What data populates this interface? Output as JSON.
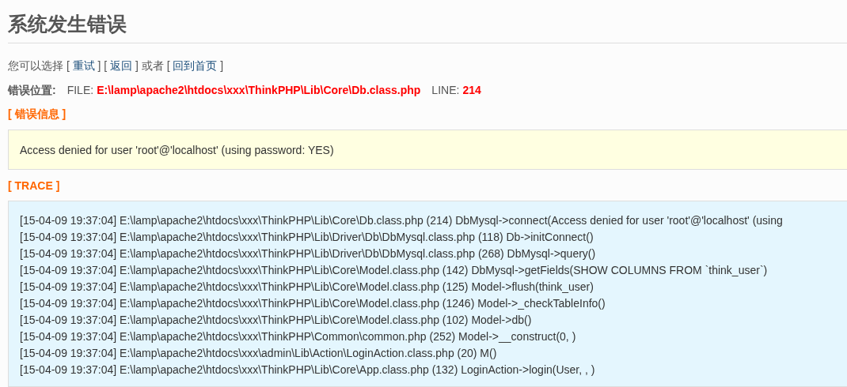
{
  "title": "系统发生错误",
  "options": [
    {
      "kind": "text",
      "text": "您可以选择 ["
    },
    {
      "kind": "link",
      "text": "重试"
    },
    {
      "kind": "text",
      "text": "] ["
    },
    {
      "kind": "link",
      "text": "返回"
    },
    {
      "kind": "text",
      "text": "] 或者 ["
    },
    {
      "kind": "link",
      "text": "回到首页"
    },
    {
      "kind": "text",
      "text": "]"
    }
  ],
  "location": {
    "label": "错误位置:",
    "file_label": "FILE:",
    "file": "E:\\lamp\\apache2\\htdocs\\xxx\\ThinkPHP\\Lib\\Core\\Db.class.php",
    "line_label": "LINE:",
    "line": "214"
  },
  "error_heading": "[ 错误信息 ]",
  "error_message": "Access denied for user 'root'@'localhost' (using password: YES)",
  "trace_heading": "[ TRACE ]",
  "trace": [
    "[15-04-09 19:37:04] E:\\lamp\\apache2\\htdocs\\xxx\\ThinkPHP\\Lib\\Core\\Db.class.php (214) DbMysql->connect(Access denied for user 'root'@'localhost' (using",
    "[15-04-09 19:37:04] E:\\lamp\\apache2\\htdocs\\xxx\\ThinkPHP\\Lib\\Driver\\Db\\DbMysql.class.php (118) Db->initConnect()",
    "[15-04-09 19:37:04] E:\\lamp\\apache2\\htdocs\\xxx\\ThinkPHP\\Lib\\Driver\\Db\\DbMysql.class.php (268) DbMysql->query()",
    "[15-04-09 19:37:04] E:\\lamp\\apache2\\htdocs\\xxx\\ThinkPHP\\Lib\\Core\\Model.class.php (142) DbMysql->getFields(SHOW COLUMNS FROM `think_user`)",
    "[15-04-09 19:37:04] E:\\lamp\\apache2\\htdocs\\xxx\\ThinkPHP\\Lib\\Core\\Model.class.php (125) Model->flush(think_user)",
    "[15-04-09 19:37:04] E:\\lamp\\apache2\\htdocs\\xxx\\ThinkPHP\\Lib\\Core\\Model.class.php (1246) Model->_checkTableInfo()",
    "[15-04-09 19:37:04] E:\\lamp\\apache2\\htdocs\\xxx\\ThinkPHP\\Lib\\Core\\Model.class.php (102) Model->db()",
    "[15-04-09 19:37:04] E:\\lamp\\apache2\\htdocs\\xxx\\ThinkPHP\\Common\\common.php (252) Model->__construct(0, )",
    "[15-04-09 19:37:04] E:\\lamp\\apache2\\htdocs\\xxx\\admin\\Lib\\Action\\LoginAction.class.php (20) M()",
    "[15-04-09 19:37:04] E:\\lamp\\apache2\\htdocs\\xxx\\ThinkPHP\\Lib\\Core\\App.class.php (132) LoginAction->login(User, , )"
  ]
}
